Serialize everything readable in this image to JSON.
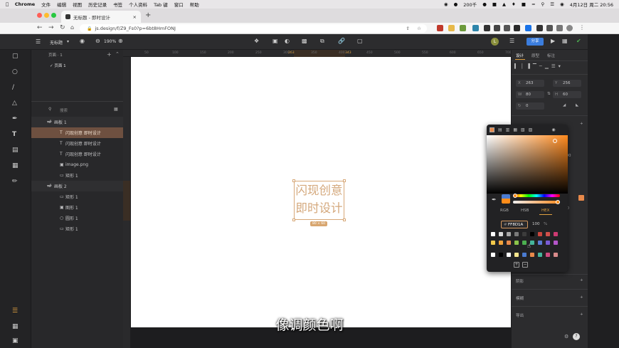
{
  "menubar": {
    "app": "Chrome",
    "items": [
      "文件",
      "编辑",
      "视图",
      "历史记录",
      "书签",
      "个人资料",
      "Tab 键",
      "窗口",
      "帮助"
    ],
    "status_temp": "200千",
    "clock": "4月12日 周二 20:56"
  },
  "browser": {
    "tab_title": "无标题 - 即时设计",
    "new_tab": "+",
    "url": "js.design/f/Z9_Fs0?p=6bt8HmFONJ"
  },
  "app_toolbar": {
    "file_name": "无标题",
    "zoom": "190%",
    "avatar_letter": "L",
    "share_label": "分享"
  },
  "layers_panel": {
    "page_header": "页面 · 1",
    "page_item": "页面 1",
    "search_placeholder": "搜索",
    "layers": [
      {
        "label": "画板 1",
        "kind": "frame",
        "state": "group"
      },
      {
        "label": "闪现创意 即时设计",
        "kind": "text",
        "state": "selected"
      },
      {
        "label": "闪现创意 即时设计",
        "kind": "text",
        "state": "normal"
      },
      {
        "label": "闪现创意 即时设计",
        "kind": "text",
        "state": "normal"
      },
      {
        "label": "image.png",
        "kind": "image",
        "state": "normal"
      },
      {
        "label": "矩形 1",
        "kind": "rect",
        "state": "normal"
      },
      {
        "label": "画板 2",
        "kind": "frame",
        "state": "group"
      },
      {
        "label": "矩形 1",
        "kind": "rect",
        "state": "normal"
      },
      {
        "label": "图形 1",
        "kind": "image",
        "state": "normal"
      },
      {
        "label": "圆形 1",
        "kind": "ellipse",
        "state": "normal"
      },
      {
        "label": "矩形 1",
        "kind": "rect",
        "state": "normal"
      }
    ]
  },
  "ruler": {
    "h_ticks": [
      "50",
      "100",
      "150",
      "200",
      "250",
      "300",
      "350",
      "400",
      "450",
      "500",
      "550",
      "600",
      "650",
      "700"
    ],
    "h_highlight": [
      "263",
      "343"
    ]
  },
  "canvas": {
    "selected_text": [
      "闪现创意",
      "即时设计"
    ],
    "size_badge": "80 × 60",
    "text_color": "#d4a87c"
  },
  "right_panel": {
    "tabs": [
      "设计",
      "原型",
      "标注"
    ],
    "x_label": "X",
    "x_value": "263",
    "y_label": "Y",
    "y_value": "256",
    "w_label": "W",
    "w_value": "80",
    "h_label": "H",
    "h_value": "60",
    "rotation": "0",
    "sections": [
      "阴影",
      "模糊",
      "导出"
    ],
    "font_size": "20",
    "opacity": "100"
  },
  "color_picker": {
    "modes": [
      "RGB",
      "HSB",
      "HEX"
    ],
    "active_mode": "HEX",
    "hex_value": "FF8D1A",
    "alpha_value": "100",
    "alpha_unit": "%",
    "current_color": "#ff8d1a",
    "swatches_row1": [
      "#ffffff",
      "#d8d8d8",
      "#a8a8a8",
      "#7a7a7a",
      "#3c3c3c",
      "#000000",
      "#c9463d",
      "#d0504a",
      "#cc3a72"
    ],
    "swatches_row2": [
      "#f2c94c",
      "#f2a33a",
      "#e8894a",
      "#8bc34a",
      "#4caf50",
      "#45b59b",
      "#5b7bd5",
      "#7a5bd5",
      "#b455c8"
    ],
    "swatches_row3": [
      "#ffffff",
      "#000000",
      "#ffffff",
      "#f6e58d",
      "#4a7bd0",
      "#e8894a",
      "#45b59b",
      "#d14a80",
      "#d88a8a"
    ]
  },
  "subtitle": "像调颜色啊"
}
